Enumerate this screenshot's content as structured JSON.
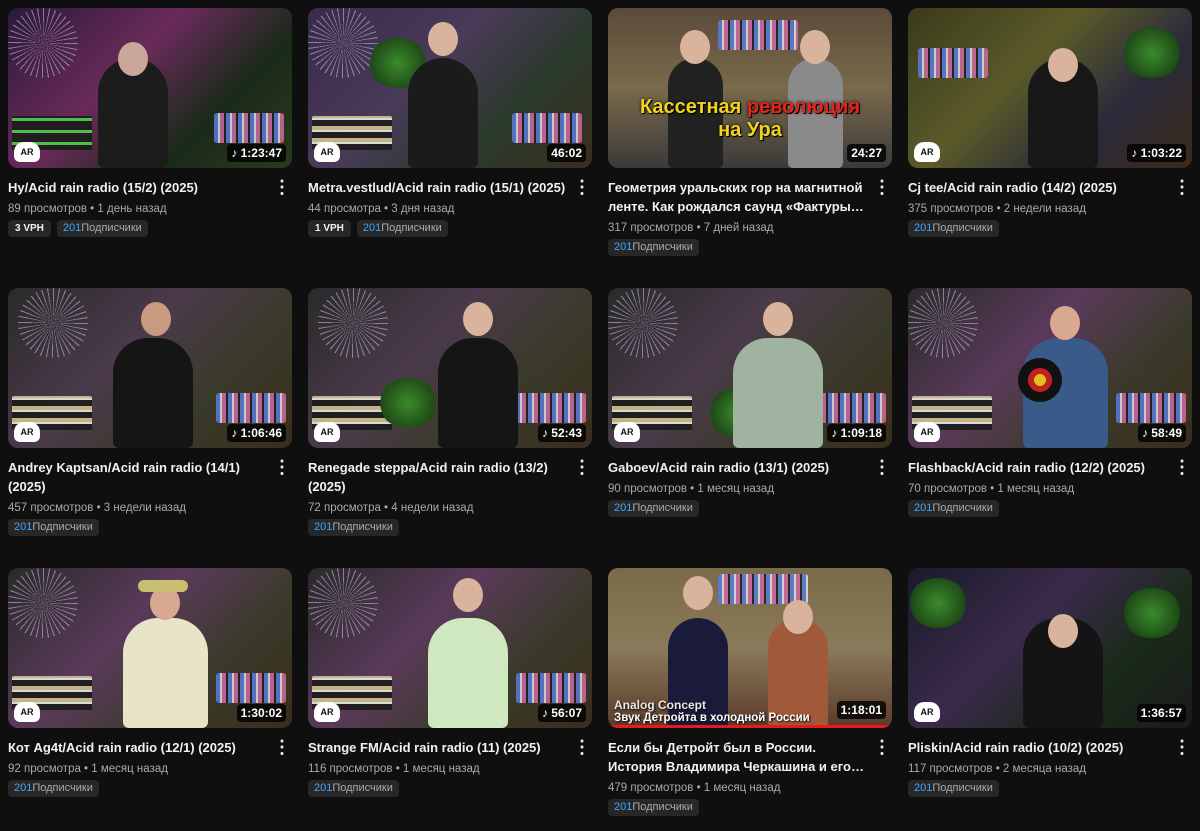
{
  "colors": {
    "background": "#0f0f0f",
    "text": "#f1f1f1",
    "secondary": "#aaaaaa",
    "accent_blue": "#3ea6ff",
    "progress_red": "#e31b1b"
  },
  "videos": [
    {
      "title": "Hy/Acid rain radio (15/2) (2025)",
      "duration": "♪ 1:23:47",
      "stats": "89 просмотров • 1 день назад",
      "vph": "3 VPH",
      "subs_num": "201",
      "subs_label": "Подписчики",
      "logo": "AR"
    },
    {
      "title": "Metra.vestlud/Acid rain radio (15/1) (2025)",
      "duration": "46:02",
      "stats": "44 просмотра • 3 дня назад",
      "vph": "1 VPH",
      "subs_num": "201",
      "subs_label": "Подписчики",
      "logo": "AR"
    },
    {
      "title": "Геометрия уральских гор на магнитной ленте. Как рождался саунд «Фактуры» /…",
      "duration": "24:27",
      "stats": "317 просмотров • 7 дней назад",
      "subs_num": "201",
      "subs_label": "Подписчики",
      "overlay_line1": "Кассетная ",
      "overlay_red": "революция",
      "overlay_line2": "на Ура"
    },
    {
      "title": "Cj tee/Acid rain radio (14/2) (2025)",
      "duration": "♪ 1:03:22",
      "stats": "375 просмотров • 2 недели назад",
      "subs_num": "201",
      "subs_label": "Подписчики",
      "logo": "AR"
    },
    {
      "title": "Andrey Kaptsan/Acid rain radio (14/1) (2025)",
      "duration": "♪ 1:06:46",
      "stats": "457 просмотров • 3 недели назад",
      "subs_num": "201",
      "subs_label": "Подписчики",
      "logo": "AR"
    },
    {
      "title": "Renegade steppa/Acid rain radio (13/2) (2025)",
      "duration": "♪ 52:43",
      "stats": "72 просмотра • 4 недели назад",
      "subs_num": "201",
      "subs_label": "Подписчики",
      "logo": "AR"
    },
    {
      "title": "Gaboev/Acid rain radio (13/1) (2025)",
      "duration": "♪ 1:09:18",
      "stats": "90 просмотров • 1 месяц назад",
      "subs_num": "201",
      "subs_label": "Подписчики",
      "logo": "AR"
    },
    {
      "title": "Flashback/Acid rain radio (12/2) (2025)",
      "duration": "♪ 58:49",
      "stats": "70 просмотров • 1 месяц назад",
      "subs_num": "201",
      "subs_label": "Подписчики",
      "logo": "AR"
    },
    {
      "title": "Кот Ag4t/Acid rain radio (12/1) (2025)",
      "duration": "1:30:02",
      "stats": "92 просмотра • 1 месяц назад",
      "subs_num": "201",
      "subs_label": "Подписчики",
      "logo": "AR"
    },
    {
      "title": "Strange FM/Acid rain radio (11) (2025)",
      "duration": "♪ 56:07",
      "stats": "116 просмотров • 1 месяц назад",
      "subs_num": "201",
      "subs_label": "Подписчики",
      "logo": "AR"
    },
    {
      "title": "Если бы Детройт был в России. История Владимира Черкашина и его лейбла…",
      "duration": "1:18:01",
      "stats": "479 просмотров • 1 месяц назад",
      "subs_num": "201",
      "subs_label": "Подписчики",
      "overlay_sub1": "Analog Concept",
      "overlay_sub2": "Звук Детройта в холодной России",
      "watch_progress": 1.0
    },
    {
      "title": "Pliskin/Acid rain radio (10/2) (2025)",
      "duration": "1:36:57",
      "stats": "117 просмотров • 2 месяца назад",
      "subs_num": "201",
      "subs_label": "Подписчики",
      "logo": "AR"
    }
  ]
}
